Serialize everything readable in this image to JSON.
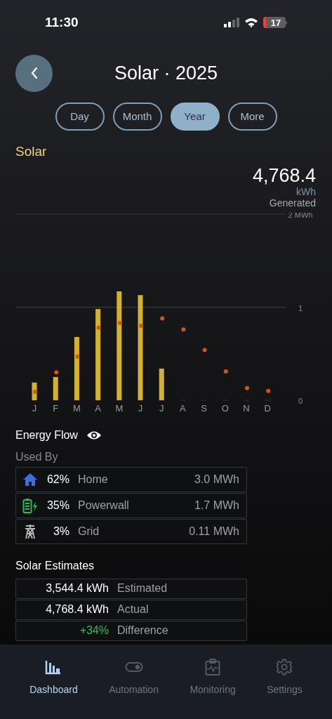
{
  "status_bar": {
    "time": "11:30",
    "battery": "17"
  },
  "header": {
    "title": "Solar · 2025"
  },
  "tabs": [
    {
      "label": "Day",
      "selected": false
    },
    {
      "label": "Month",
      "selected": false
    },
    {
      "label": "Year",
      "selected": true
    },
    {
      "label": "More",
      "selected": false
    }
  ],
  "solar": {
    "title": "Solar",
    "total": "4,768.4",
    "unit": "kWh",
    "caption": "Generated",
    "chart_data": {
      "type": "bar",
      "categories": [
        "J",
        "F",
        "M",
        "A",
        "M",
        "J",
        "J",
        "A",
        "S",
        "O",
        "N",
        "D"
      ],
      "series": [
        {
          "type": "bar",
          "color": "#d4b22e",
          "values": [
            0.19,
            0.25,
            0.68,
            0.98,
            1.17,
            1.13,
            0.34,
            null,
            null,
            null,
            null,
            null
          ]
        },
        {
          "type": "scatter",
          "color": "#d4570f",
          "values": [
            0.09,
            0.3,
            0.47,
            0.78,
            0.83,
            0.8,
            0.88,
            0.76,
            0.54,
            0.31,
            0.13,
            0.1
          ]
        }
      ],
      "ylim": [
        0,
        2
      ],
      "yticks": [
        0,
        1,
        {
          "value": 2,
          "label": "2 MWh"
        }
      ]
    }
  },
  "energy_flow": {
    "title": "Energy Flow",
    "subtitle": "Used By",
    "rows": [
      {
        "kind": "home",
        "percent": "62%",
        "label": "Home",
        "value": "3.0 MWh"
      },
      {
        "kind": "powerwall",
        "percent": "35%",
        "label": "Powerwall",
        "value": "1.7 MWh"
      },
      {
        "kind": "grid",
        "percent": "3%",
        "label": "Grid",
        "value": "0.11 MWh"
      }
    ]
  },
  "estimates": {
    "title": "Solar Estimates",
    "rows": [
      {
        "kind": "plain",
        "value": "3,544.4 kWh",
        "label": "Estimated"
      },
      {
        "kind": "plain",
        "value": "4,768.4 kWh",
        "label": "Actual"
      },
      {
        "kind": "positive",
        "value": "+34%",
        "label": "Difference"
      }
    ]
  },
  "nav": [
    {
      "kind": "dashboard",
      "label": "Dashboard",
      "selected": true
    },
    {
      "kind": "automation",
      "label": "Automation",
      "selected": false
    },
    {
      "kind": "monitoring",
      "label": "Monitoring",
      "selected": false
    },
    {
      "kind": "settings",
      "label": "Settings",
      "selected": false
    }
  ]
}
